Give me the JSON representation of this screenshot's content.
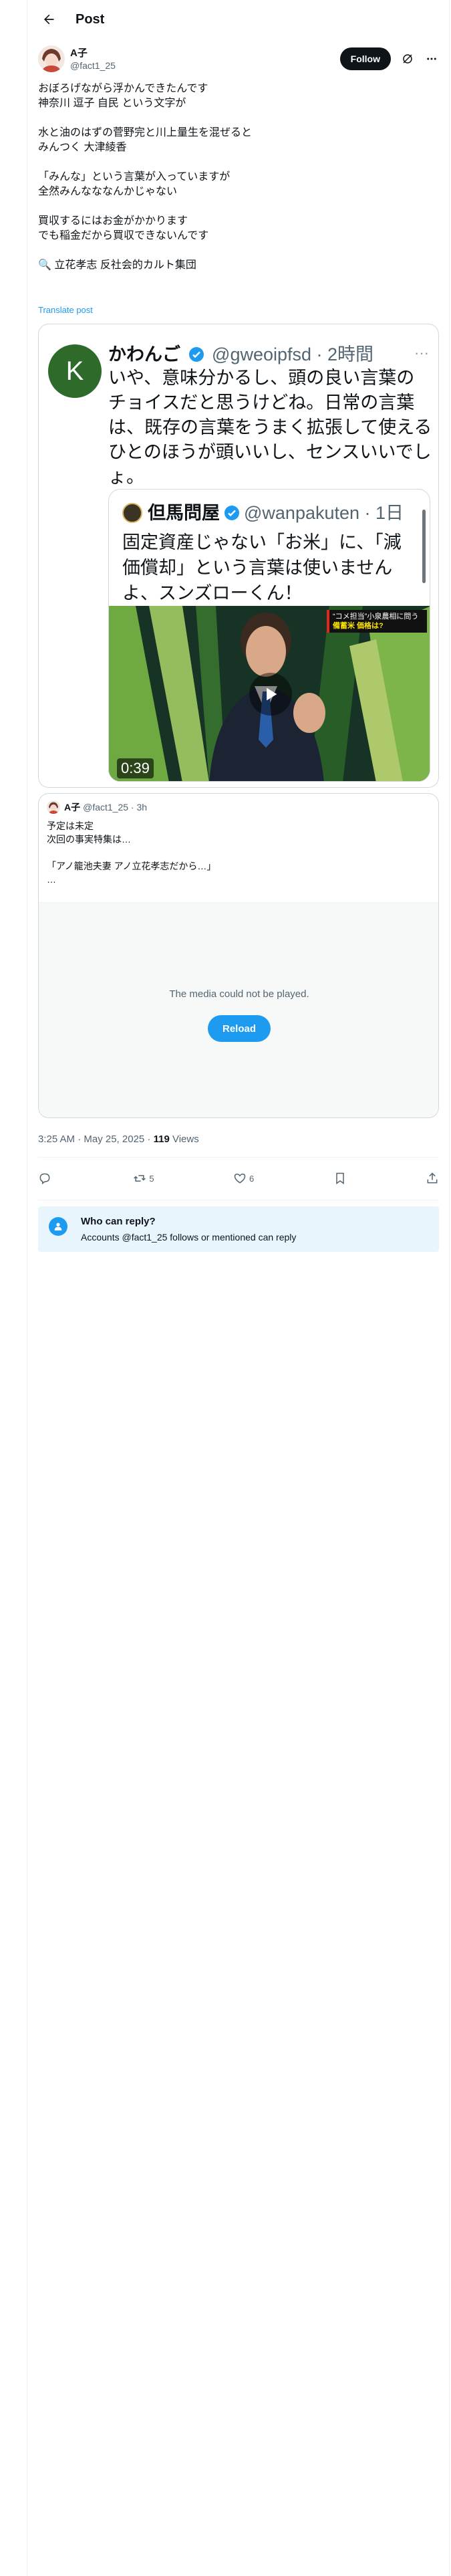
{
  "header": {
    "title": "Post",
    "back_icon": "arrow-left-icon"
  },
  "author": {
    "display_name": "A子",
    "handle": "@fact1_25",
    "follow_label": "Follow",
    "actions_icons": [
      "grok-icon",
      "more-icon"
    ]
  },
  "post": {
    "lines": [
      "おぼろげながら浮かんできたんです",
      "神奈川 逗子 自民 という文字が",
      "",
      "水と油のはずの菅野完と川上量生を混ぜると",
      "みんつく 大津綾香",
      "",
      "「みんな」という言葉が入っていますが",
      "全然みんなななんかじゃない",
      "",
      "買収するにはお金がかかります",
      "でも稲金だから買収できないんです",
      "",
      "🔍 立花孝志 反社会的カルト集団"
    ],
    "translate_label": "Translate post"
  },
  "embedded_image": {
    "avatar_letter": "K",
    "name": "かわんご",
    "handle_time": "@gweoipfsd · 2時間",
    "text": "いや、意味分かるし、頭の良い言葉のチョイスだと思うけどね。日常の言葉は、既存の言葉をうまく拡張して使えるひとのほうが頭いいし、センスいいでしょ。",
    "inner": {
      "name": "但馬問屋",
      "handle_time": "@wanpakuten · 1日",
      "text": "固定資産じゃない「お米」に、「減価償却」という言葉は使いませんよ、スンズローくん！",
      "video_time": "0:39",
      "news_tag_line1": "“コメ担当”小泉農相に問う",
      "news_tag_line2": "備蓄米 価格は?"
    }
  },
  "quote": {
    "name": "A子",
    "handle": "@fact1_25",
    "time": "3h",
    "lines": [
      "予定は未定",
      "次回の事実特集は…",
      "",
      "「アノ籠池夫妻 アノ立花孝志だから…」",
      "…"
    ],
    "media_message": "The media could not be played.",
    "reload_label": "Reload"
  },
  "meta": {
    "timestamp": "3:25 AM · May 25, 2025 · ",
    "views_count": "119",
    "views_label": " Views"
  },
  "actions": {
    "reply_count": "",
    "retweet_count": "5",
    "like_count": "6"
  },
  "reply_restriction": {
    "title": "Who can reply?",
    "subtitle": "Accounts @fact1_25 follows or mentioned can reply"
  },
  "colors": {
    "accent": "#1d9bf0",
    "text": "#0f1419",
    "secondary": "#536471",
    "border": "#cfd9de"
  }
}
